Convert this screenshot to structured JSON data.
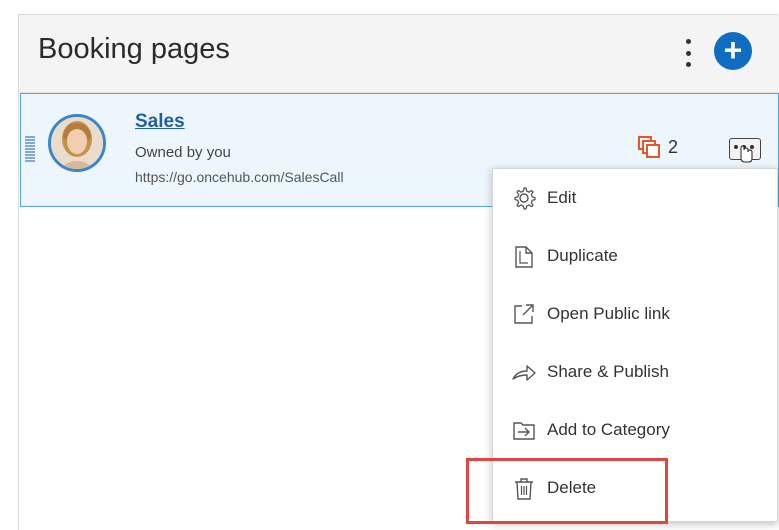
{
  "header": {
    "title": "Booking pages"
  },
  "booking_page": {
    "title": "Sales",
    "owner": "Owned by you",
    "url": "https://go.oncehub.com/SalesCall",
    "copies_count": "2"
  },
  "context_menu": {
    "items": [
      {
        "label": "Edit",
        "icon": "gear-icon"
      },
      {
        "label": "Duplicate",
        "icon": "duplicate-icon"
      },
      {
        "label": "Open Public link",
        "icon": "external-link-icon"
      },
      {
        "label": "Share & Publish",
        "icon": "share-icon"
      },
      {
        "label": "Add to Category",
        "icon": "add-to-category-icon"
      },
      {
        "label": "Delete",
        "icon": "trash-icon"
      }
    ]
  },
  "colors": {
    "accent": "#0f6cc0",
    "row_bg": "#eef6fd",
    "row_border": "#5aa6de",
    "copies_icon": "#e2582d",
    "highlight": "#e0453f"
  }
}
